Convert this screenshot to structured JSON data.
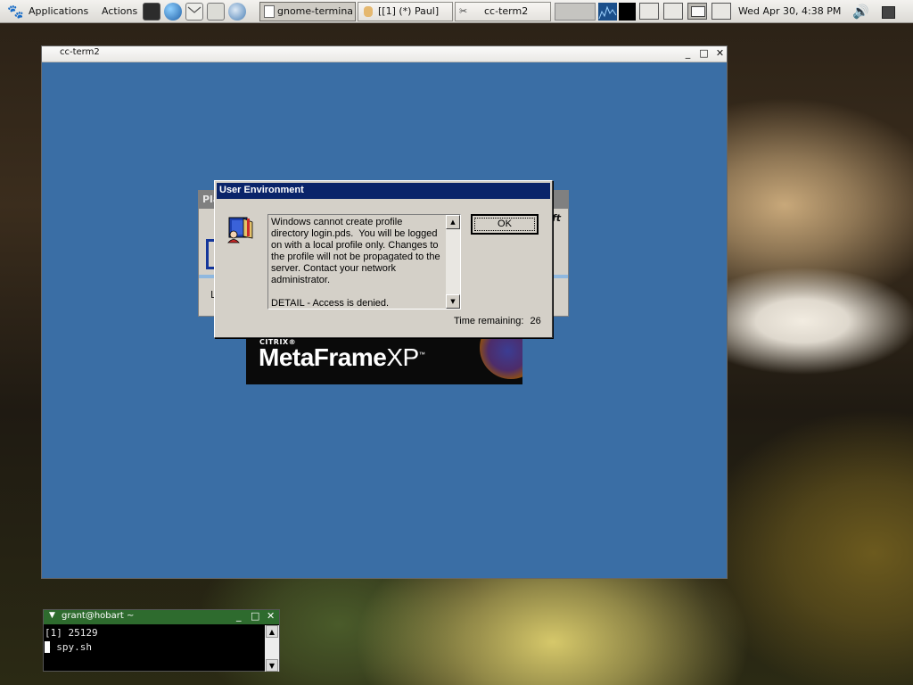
{
  "panel": {
    "menus": [
      "Applications",
      "Actions"
    ],
    "launchers": [
      "terminal-launcher-icon",
      "web-browser-icon",
      "mail-icon",
      "calculator-icon",
      "network-icon"
    ],
    "tasks": [
      {
        "label": "gnome-termina",
        "icon": "document-icon",
        "active": true
      },
      {
        "label": "[[1] (*) Paul]",
        "icon": "user-icon",
        "active": false
      },
      {
        "label": "cc-term2",
        "icon": "citrix-icon",
        "active": false
      }
    ],
    "workspaces": 4,
    "current_workspace": 3,
    "clock": "Wed Apr 30,  4:38 PM",
    "icons": [
      "volume-icon",
      "notification-icon",
      "system-monitor-icon"
    ]
  },
  "cc_window": {
    "title": "cc-term2",
    "buttons": [
      "minimize",
      "maximize",
      "close"
    ]
  },
  "behind_dialog": {
    "title_fragment": "Pla",
    "brand_fragment": "oft",
    "label_fragment": "L"
  },
  "metaframe_banner": {
    "company": "CITRIX®",
    "product": "MetaFrame",
    "edition": "XP",
    "tm": "™"
  },
  "user_env_dialog": {
    "title": "User Environment",
    "message": "Windows cannot create profile directory login.pds.  You will be logged on with a local profile only. Changes to the profile will not be propagated to the server. Contact your network administrator.\n\nDETAIL - Access is denied.",
    "ok_label": "OK",
    "timer_label": "Time remaining:",
    "timer_value": "26",
    "icon": "user-profile-icon"
  },
  "terminal": {
    "title": "grant@hobart ~",
    "lines": [
      "[1] 25129",
      "> spy.sh"
    ],
    "prompt_symbol": ">"
  },
  "colors": {
    "desktop_blue": "#3a6ea5",
    "dialog_caption": "#0a246a",
    "terminal_title": "#2e6b2e"
  }
}
